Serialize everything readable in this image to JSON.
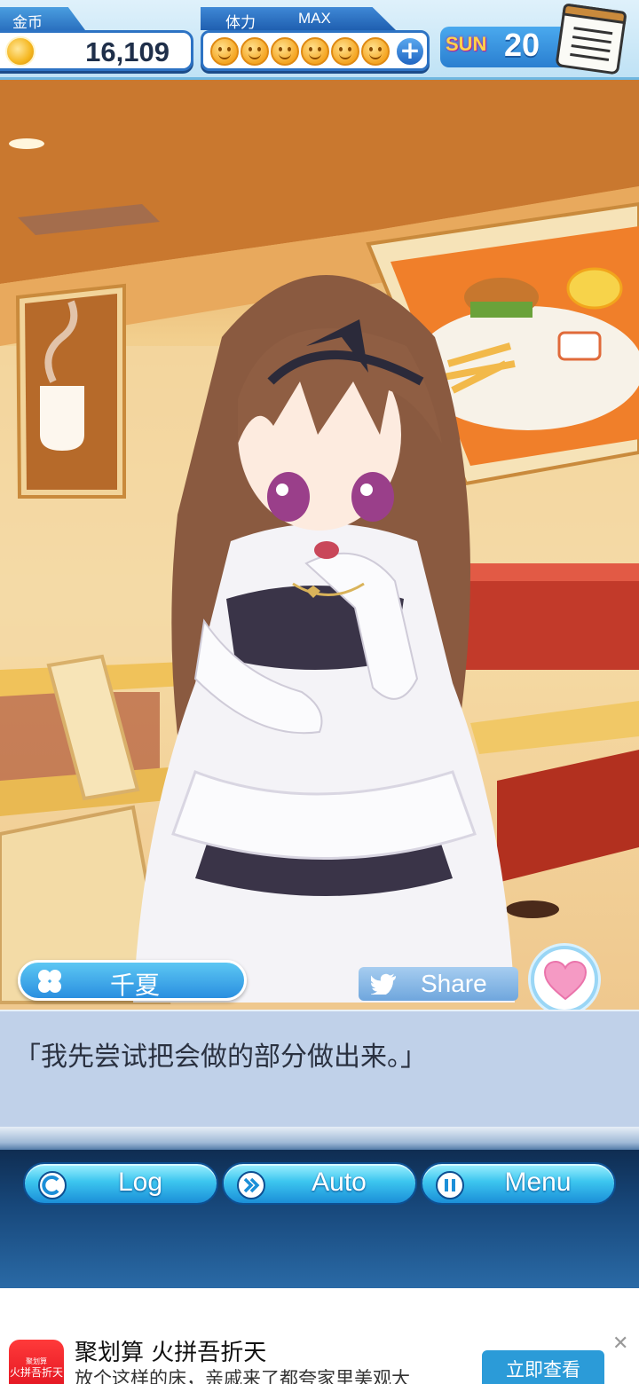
{
  "hud": {
    "coins_label": "金币",
    "coins_value": "16,109",
    "stamina_label": "体力",
    "stamina_status": "MAX",
    "stamina_points": 6,
    "stamina_max": 6,
    "day_name": "SUN",
    "day_number": "20"
  },
  "character": {
    "name": "千夏"
  },
  "share": {
    "label": "Share"
  },
  "dialog": {
    "text": "「我先尝试把会做的部分做出来。」"
  },
  "controls": {
    "log_label": "Log",
    "auto_label": "Auto",
    "menu_label": "Menu"
  },
  "ad": {
    "logo_top": "聚划算",
    "logo_main": "火拼吾折天",
    "title": "聚划算 火拼吾折天",
    "description": "放个这样的床，亲戚来了都夸家里美观大",
    "cta_label": "立即查看",
    "close_symbol": "✕"
  },
  "colors": {
    "hud_blue": "#2d73c4",
    "button_cyan": "#3cc5ef",
    "dialog_bg": "#bed0e8",
    "ad_cta": "#2b9bd8"
  }
}
